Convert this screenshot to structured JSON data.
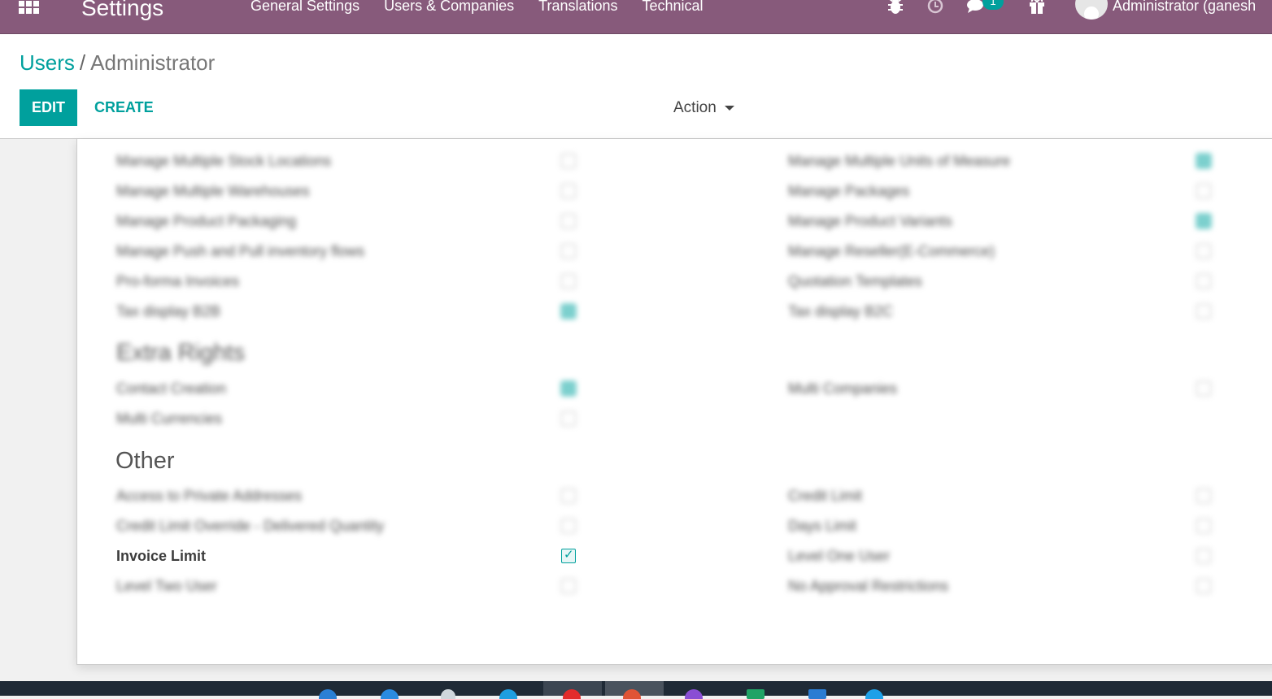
{
  "navbar": {
    "app_title": "Settings",
    "menu": [
      "General Settings",
      "Users & Companies",
      "Translations",
      "Technical"
    ],
    "chat_badge": "1",
    "user": "Administrator (ganesh"
  },
  "breadcrumb": {
    "parent": "Users",
    "separator": "/",
    "current": "Administrator"
  },
  "buttons": {
    "edit": "EDIT",
    "create": "CREATE",
    "action": "Action"
  },
  "sections": {
    "extra_rights_title": "Extra Rights",
    "other_title": "Other"
  },
  "rows": {
    "left": [
      {
        "label": "Manage Multiple Stock Locations",
        "checked": false
      },
      {
        "label": "Manage Multiple Warehouses",
        "checked": false
      },
      {
        "label": "Manage Product Packaging",
        "checked": false
      },
      {
        "label": "Manage Push and Pull inventory flows",
        "checked": false
      },
      {
        "label": "Pro-forma Invoices",
        "checked": false
      },
      {
        "label": "Tax display B2B",
        "checked": true
      }
    ],
    "right": [
      {
        "label": "Manage Multiple Units of Measure",
        "checked": true
      },
      {
        "label": "Manage Packages",
        "checked": false
      },
      {
        "label": "Manage Product Variants",
        "checked": true
      },
      {
        "label": "Manage Reseller(E-Commerce)",
        "checked": false
      },
      {
        "label": "Quotation Templates",
        "checked": false
      },
      {
        "label": "Tax display B2C",
        "checked": false
      }
    ],
    "extra_left": [
      {
        "label": "Contact Creation",
        "checked": true
      },
      {
        "label": "Multi Currencies",
        "checked": false
      }
    ],
    "extra_right": [
      {
        "label": "Multi Companies",
        "checked": false
      }
    ],
    "other_left": [
      {
        "label": "Access to Private Addresses",
        "checked": false
      },
      {
        "label": "Credit Limit Override - Delivered Quantity",
        "checked": false
      },
      {
        "label": "Invoice Limit",
        "checked": true
      },
      {
        "label": "Level Two User",
        "checked": false
      }
    ],
    "other_right": [
      {
        "label": "Credit Limit",
        "checked": false
      },
      {
        "label": "Days Limit",
        "checked": false
      },
      {
        "label": "Level One User",
        "checked": false
      },
      {
        "label": "No Approval Restrictions",
        "checked": false
      }
    ]
  }
}
